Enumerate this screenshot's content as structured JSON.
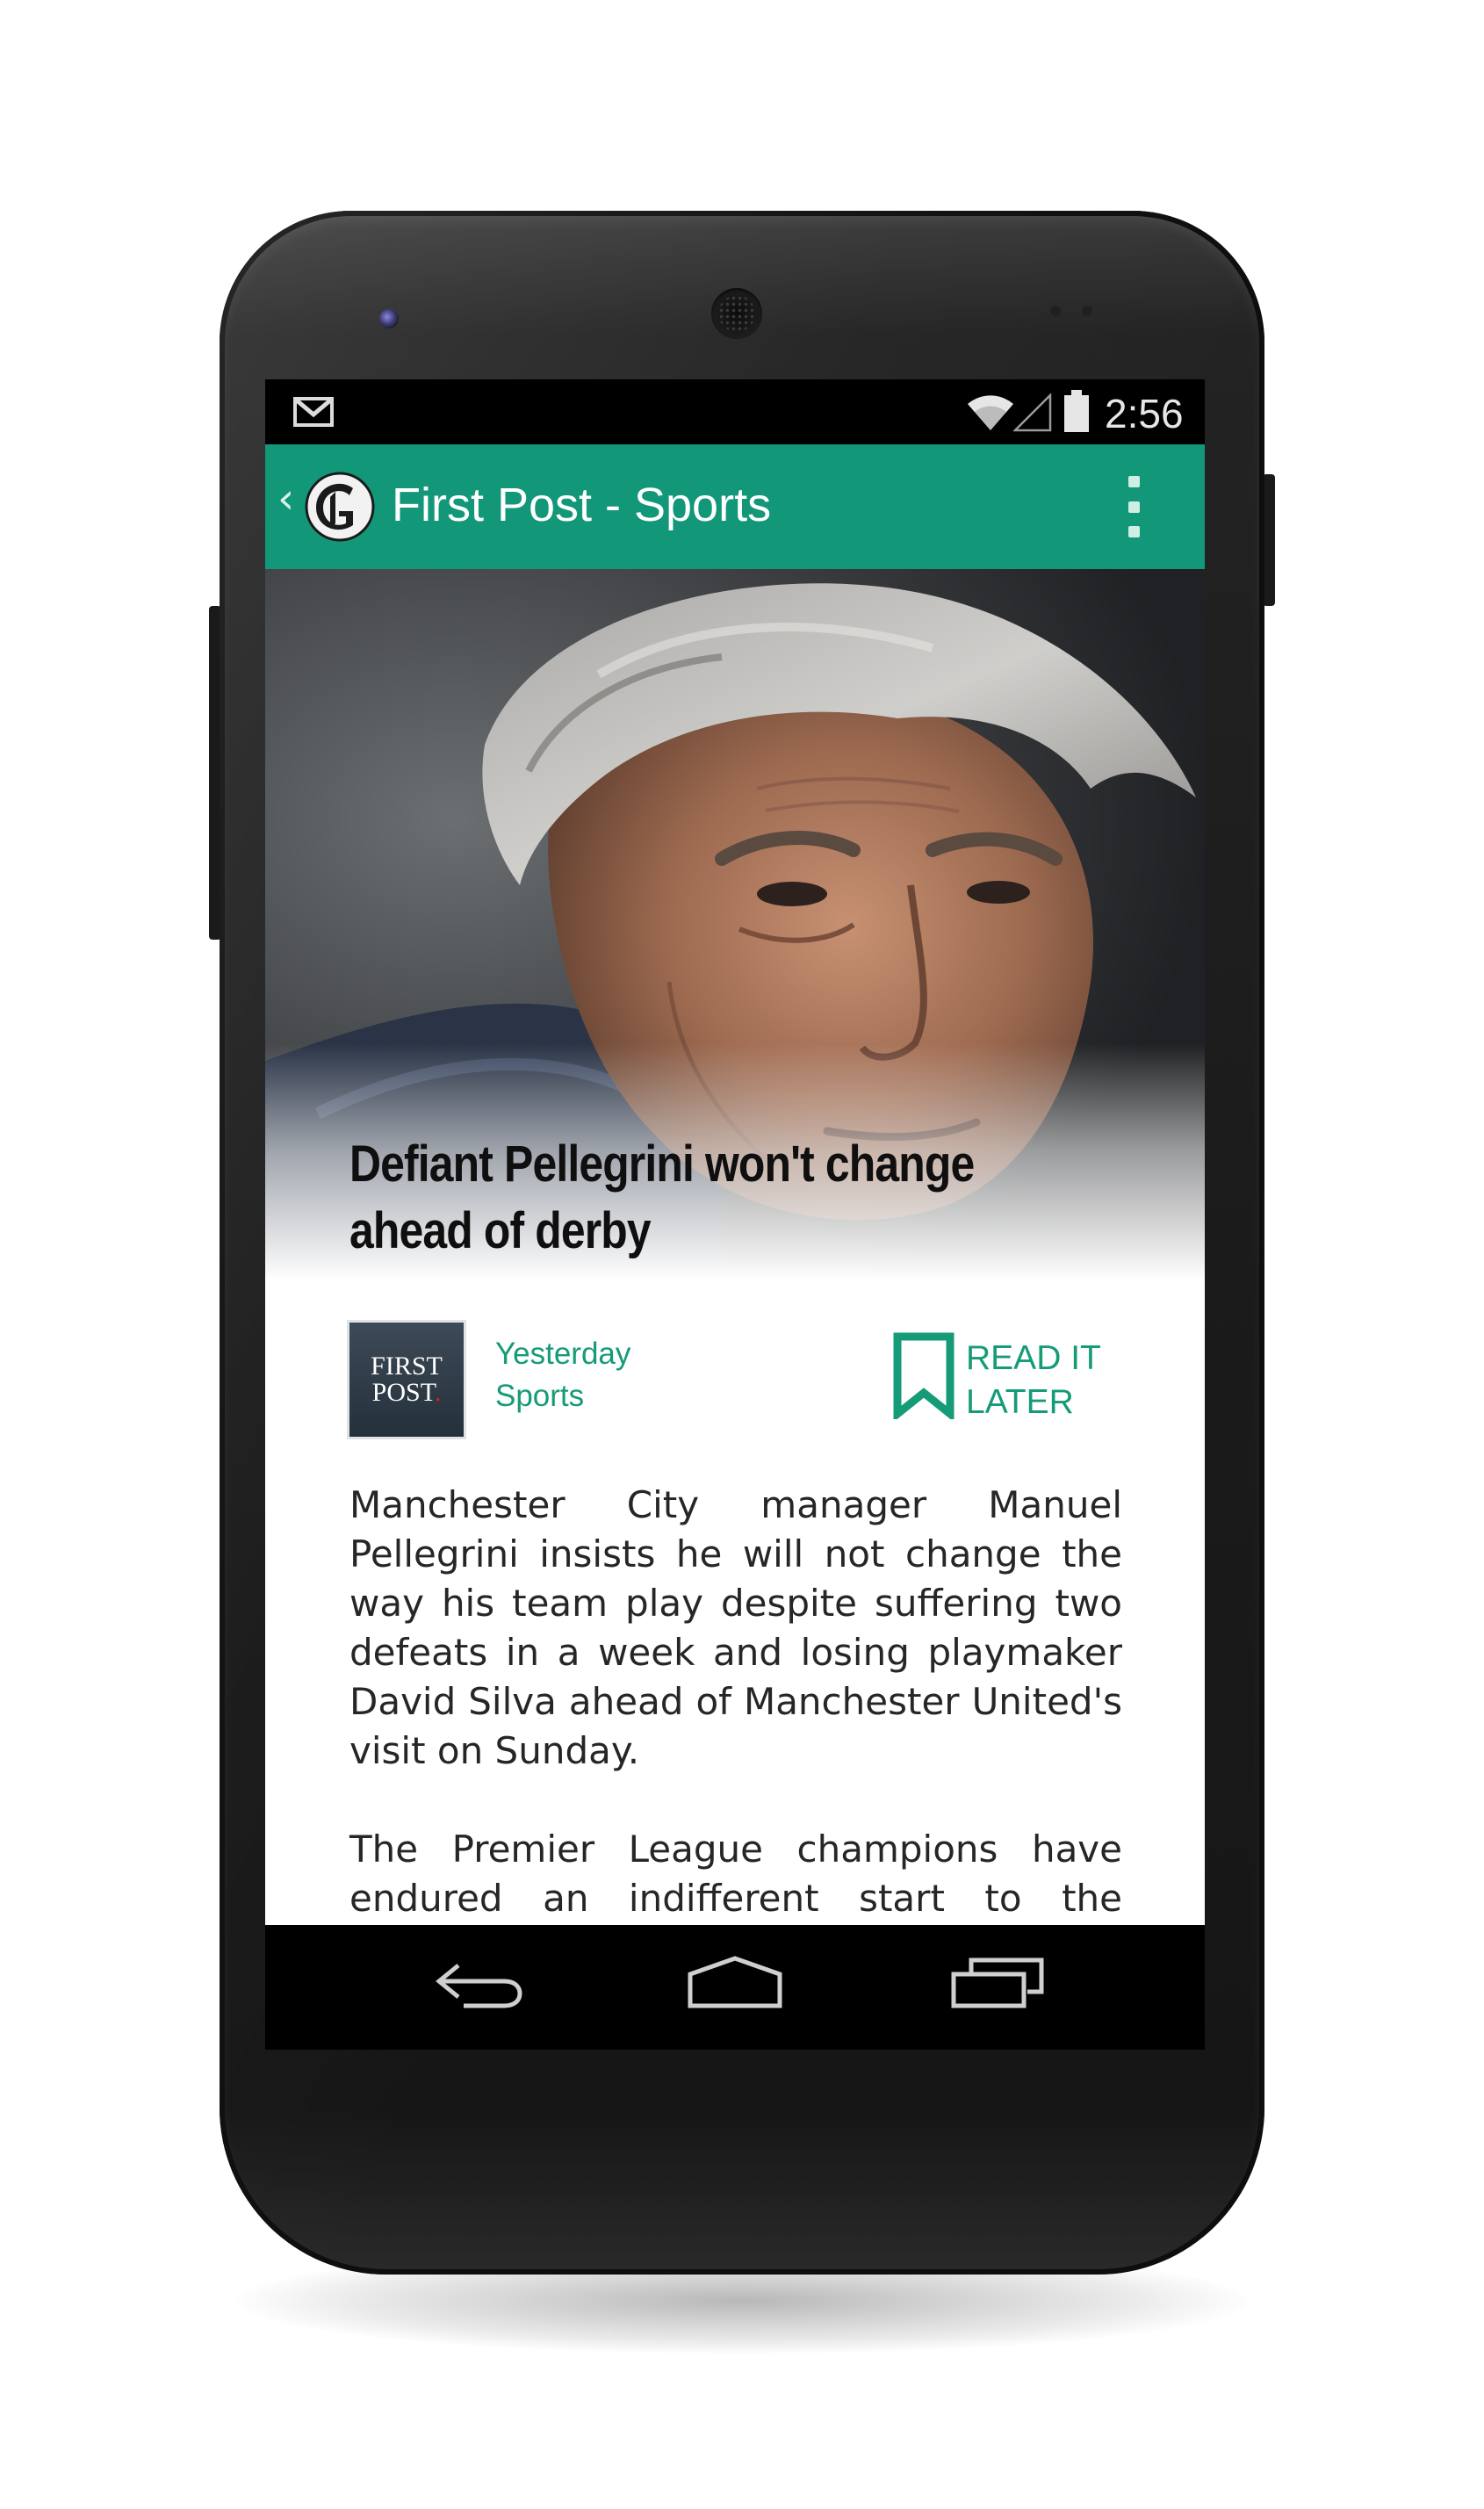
{
  "status_bar": {
    "time": "2:56",
    "notification_icon": "gmail-icon",
    "icons": [
      "wifi-icon",
      "signal-icon",
      "battery-icon"
    ]
  },
  "action_bar": {
    "title": "First Post - Sports",
    "up_icon": "chevron-left-icon",
    "logo_icon": "gothic-g-logo-icon",
    "menu_icon": "overflow-menu-icon",
    "color": "#139779"
  },
  "article": {
    "hero_image": "portrait-photo",
    "headline": "Defiant Pellegrini won't change\nahead of derby",
    "source_logo": {
      "line1": "FIRST",
      "line2": "POST",
      "dot": "."
    },
    "date": "Yesterday",
    "category": "Sports",
    "read_later_label": "READ IT\nLATER",
    "read_later_icon": "bookmark-icon",
    "paragraphs": [
      "Manchester City manager Manuel Pellegrini insists he will not change the way his team play despite suffering two defeats in a week and losing playmaker David Silva ahead of Manchester United's visit on Sunday.",
      "The Premier League champions have endured an indifferent start to the season"
    ]
  },
  "nav_bar": {
    "icons": [
      "back-icon",
      "home-icon",
      "recent-apps-icon"
    ]
  },
  "colors": {
    "accent": "#169b79",
    "status_bar": "#000000"
  }
}
